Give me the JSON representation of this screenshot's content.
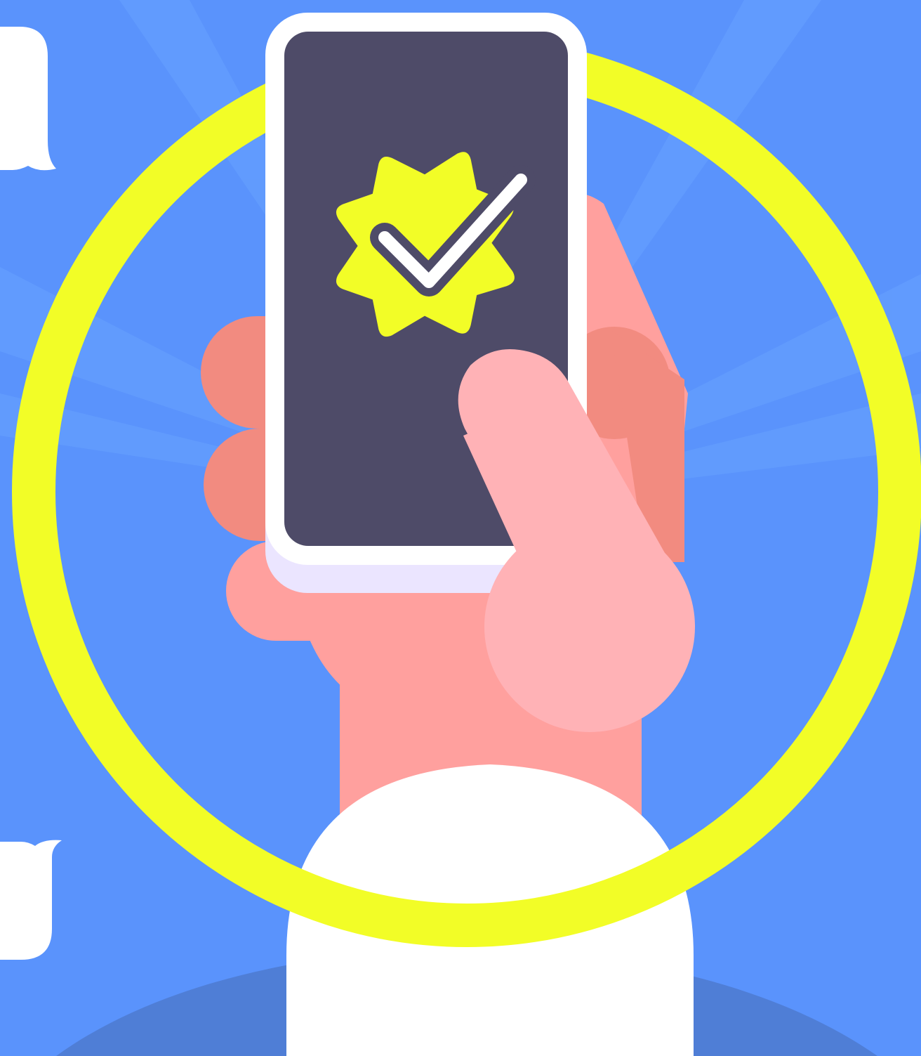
{
  "illustration": {
    "icons": {
      "phone": "smartphone-icon",
      "badge": "verified-badge-icon",
      "check": "checkmark-icon",
      "chat_top": "chat-bubble-icon",
      "chat_bottom": "chat-bubble-icon"
    },
    "colors": {
      "background": "#5a93fc",
      "background_ray": "#67a3ff",
      "background_ground": "#4f7ed6",
      "ring": "#f2fd27",
      "phone_frame": "#ffffff",
      "phone_frame_shadow": "#ebe5ff",
      "phone_screen": "#4e4b68",
      "badge": "#f2fd27",
      "check": "#ffffff",
      "check_outline": "#4e4b68",
      "hand": "#ffa09e",
      "fingers_back": "#f28b80",
      "thumb": "#ffb2b6",
      "sleeve": "#ffffff",
      "chat_bubble": "#ffffff"
    }
  }
}
